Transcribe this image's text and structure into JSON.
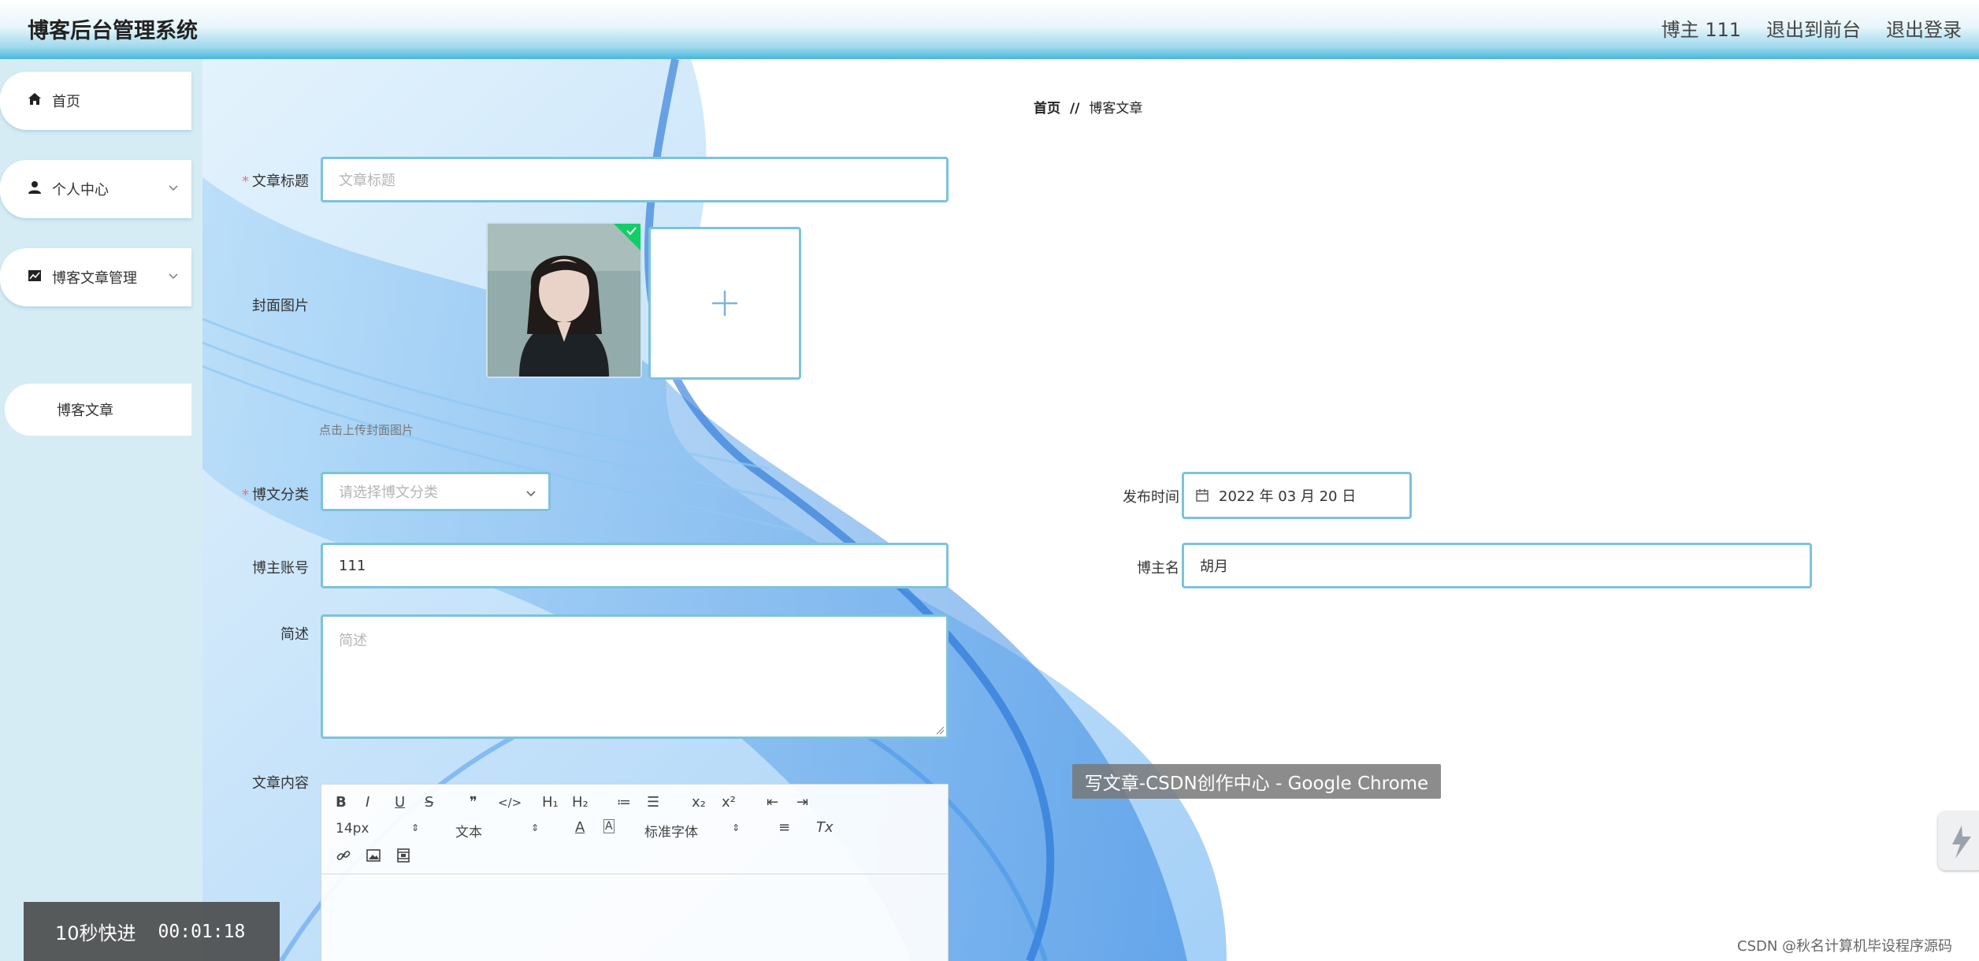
{
  "header": {
    "title": "博客后台管理系统",
    "user_label": "博主 111",
    "front_label": "退出到前台",
    "logout_label": "退出登录"
  },
  "sidebar": {
    "items": [
      {
        "label": "首页",
        "icon": "home-icon"
      },
      {
        "label": "个人中心",
        "icon": "user-icon"
      },
      {
        "label": "博客文章管理",
        "icon": "chart-icon"
      }
    ],
    "subitem": {
      "label": "博客文章"
    }
  },
  "breadcrumb": {
    "home": "首页",
    "separator": "//",
    "current": "博客文章"
  },
  "form": {
    "title": {
      "label": "文章标题",
      "placeholder": "文章标题"
    },
    "cover": {
      "label": "封面图片",
      "tip": "点击上传封面图片"
    },
    "category": {
      "label": "博文分类",
      "placeholder": "请选择博文分类"
    },
    "publish_time": {
      "label": "发布时间",
      "value": "2022 年 03 月 20 日"
    },
    "account": {
      "label": "博主账号",
      "value": "111"
    },
    "blogger_name": {
      "label": "博主名",
      "value": "胡月"
    },
    "summary": {
      "label": "简述",
      "placeholder": "简述"
    },
    "content": {
      "label": "文章内容"
    }
  },
  "editor": {
    "buttons": {
      "bold": "B",
      "italic": "I",
      "underline": "U",
      "strike": "S",
      "quote": "❞",
      "code": "</>",
      "h1": "H₁",
      "h2": "H₂",
      "ordered_list": "≔",
      "bullet_list": "☰",
      "subscript": "x₂",
      "superscript": "x²",
      "outdent": "⇤",
      "indent": "⇥",
      "font_color": "A",
      "bg_color": "A",
      "align": "≡",
      "clear": "Tx"
    },
    "size_value": "14px",
    "header_value": "文本",
    "font_value": "标准字体"
  },
  "overlays": {
    "tooltip": "写文章-CSDN创作中心 - Google Chrome",
    "player_label": "10秒快进",
    "player_time": "00:01:18",
    "watermark": "CSDN @秋名计算机毕设程序源码"
  },
  "colors": {
    "accent": "#7cc3dc",
    "sidebar_bg": "#d6ecf4",
    "header_accent": "#48b7de",
    "required": "#f56c6c"
  }
}
